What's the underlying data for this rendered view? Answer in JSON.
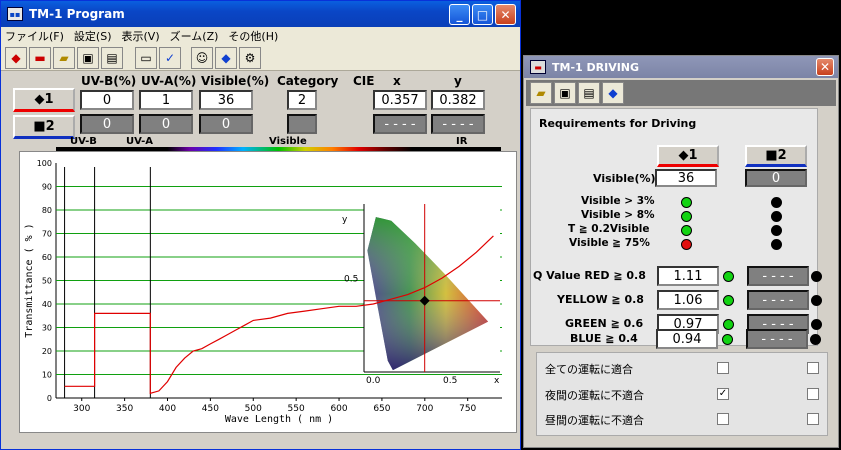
{
  "main_window": {
    "title": "TM-1 Program",
    "menu": [
      "ファイル(F)",
      "設定(S)",
      "表示(V)",
      "ズーム(Z)",
      "その他(H)"
    ],
    "selector_1": "◆1",
    "selector_2": "■2",
    "headers": {
      "uvb": "UV-B(%)",
      "uva": "UV-A(%)",
      "visible": "Visible(%)",
      "category": "Category",
      "cie": "CIE",
      "x": "x",
      "y": "y"
    },
    "row1": {
      "uvb": "0",
      "uva": "1",
      "visible": "36",
      "category": "2",
      "x": "0.357",
      "y": "0.382"
    },
    "row2": {
      "uvb": "0",
      "uva": "0",
      "visible": "0",
      "category": "",
      "x": "- - - -",
      "y": "- - - -"
    },
    "band_labels": {
      "uvb": "UV-B",
      "uva": "UV-A",
      "visible": "Visible",
      "ir": "IR"
    },
    "chart": {
      "ylabel": "Transmittance ( % )",
      "xlabel": "Wave Length ( nm )",
      "y_ticks": [
        "100",
        "90",
        "80",
        "70",
        "60",
        "50",
        "40",
        "30",
        "20",
        "10",
        "0"
      ],
      "x_ticks": [
        "300",
        "350",
        "400",
        "450",
        "500",
        "550",
        "600",
        "650",
        "700",
        "750"
      ],
      "cie_ticks_x": [
        "0.0",
        "0.5",
        "x"
      ],
      "cie_ticks_y": [
        "0.5",
        "y"
      ]
    }
  },
  "chart_data": {
    "type": "line",
    "title": "",
    "xlabel": "Wave Length ( nm )",
    "ylabel": "Transmittance ( % )",
    "xlim": [
      270,
      790
    ],
    "ylim": [
      0,
      100
    ],
    "grid": true,
    "series": [
      {
        "x": [
          280,
          315,
          315,
          380,
          380,
          390,
          400,
          410,
          420,
          430,
          440,
          450,
          460,
          470,
          480,
          490,
          500,
          520,
          540,
          560,
          580,
          600,
          620,
          640,
          660,
          680,
          700,
          720,
          740,
          760,
          780
        ],
        "y": [
          5,
          5,
          36,
          36,
          2,
          3,
          7,
          13,
          17,
          20,
          21,
          23,
          25,
          27,
          29,
          31,
          33,
          34,
          36,
          37,
          38,
          39,
          39,
          40,
          42,
          44,
          47,
          51,
          56,
          62,
          69
        ],
        "color": "#e00000"
      }
    ],
    "cie_point": {
      "x": 0.357,
      "y": 0.382
    }
  },
  "driving_window": {
    "title": "TM-1 DRIVING",
    "heading": "Requirements for Driving",
    "selector_1": "◆1",
    "selector_2": "■2",
    "visible_label": "Visible(%)",
    "visible_1": "36",
    "visible_2": "0",
    "criteria": [
      "Visible > 3%",
      "Visible > 8%",
      "T ≧ 0.2Visible",
      "Visible ≧ 75%"
    ],
    "criteria_status_1": [
      "green",
      "green",
      "green",
      "red"
    ],
    "criteria_status_2": [
      "black",
      "black",
      "black",
      "black"
    ],
    "q_rows": [
      {
        "label": "Q Value  RED ≧ 0.8",
        "v1": "1.11",
        "v2": "- - - -"
      },
      {
        "label": "YELLOW ≧ 0.8",
        "v1": "1.06",
        "v2": "- - - -"
      },
      {
        "label": "GREEN ≧ 0.6",
        "v1": "0.97",
        "v2": "- - - -"
      },
      {
        "label": "BLUE ≧ 0.4",
        "v1": "0.94",
        "v2": "- - - -"
      }
    ],
    "checks": [
      {
        "label": "全ての運転に適合",
        "c1": "",
        "c2": ""
      },
      {
        "label": "夜間の運転に不適合",
        "c1": "✓",
        "c2": ""
      },
      {
        "label": "昼間の運転に不適合",
        "c1": "",
        "c2": ""
      }
    ]
  }
}
